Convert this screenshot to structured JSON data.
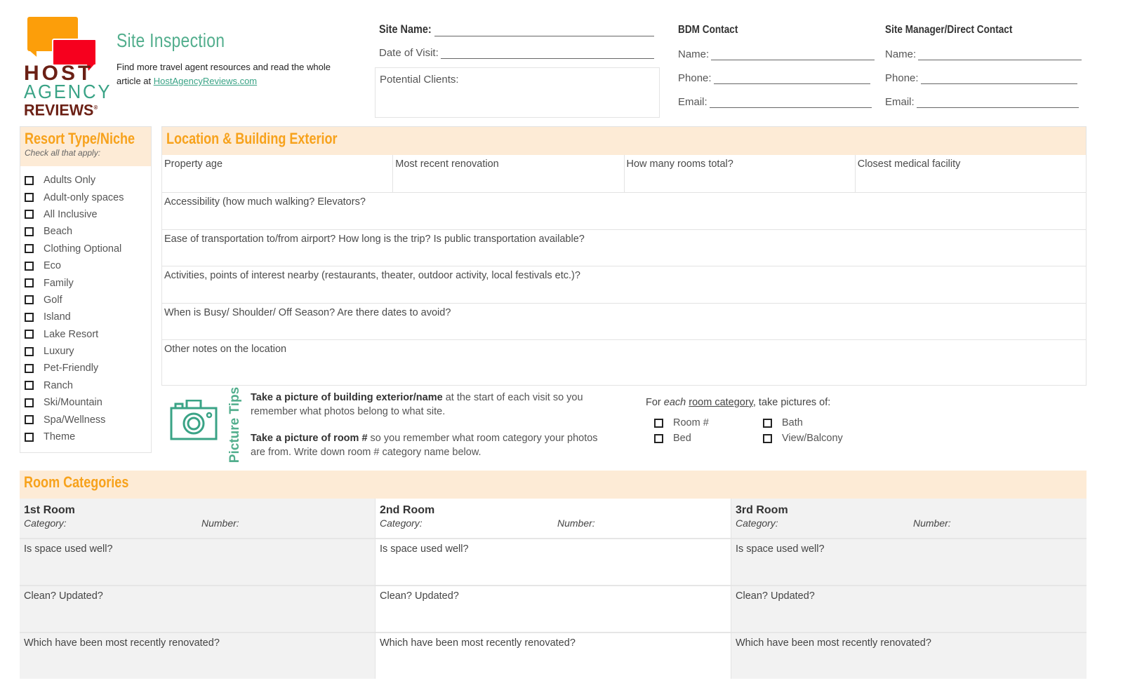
{
  "logo": {
    "line1": "HOST",
    "line2": "AGENCY",
    "line3": "REVIEWS",
    "mark": "®",
    "colors": {
      "orange": "#fc9e0a",
      "red": "#f6001e",
      "brown": "#6b2015",
      "teal": "#3aa386"
    }
  },
  "header": {
    "title": "Site Inspection",
    "subtitle_prefix": "Find more travel agent resources and read the whole article at ",
    "subtitle_link": "HostAgencyReviews.com",
    "site_name_label": "Site Name:",
    "date_label": "Date of Visit:",
    "potential_clients_label": "Potential Clients:"
  },
  "contacts": [
    {
      "title": "BDM Contact",
      "fields": [
        "Name:",
        "Phone:",
        "Email:"
      ]
    },
    {
      "title": "Site Manager/Direct Contact",
      "fields": [
        "Name:",
        "Phone:",
        "Email:"
      ]
    }
  ],
  "resort_type": {
    "title": "Resort Type/Niche",
    "subtitle": "Check all that apply:",
    "options": [
      "Adults Only",
      "Adult-only spaces",
      "All Inclusive",
      "Beach",
      "Clothing Optional",
      "Eco",
      "Family",
      "Golf",
      "Island",
      "Lake Resort",
      "Luxury",
      "Pet-Friendly",
      "Ranch",
      "Ski/Mountain",
      "Spa/Wellness",
      "Theme"
    ]
  },
  "location": {
    "title": "Location & Building Exterior",
    "top_cells": [
      "Property age",
      "Most recent renovation",
      "How many rooms total?",
      "Closest medical facility"
    ],
    "rows": [
      "Accessibility (how much walking? Elevators?",
      "Ease of transportation to/from airport? How long is the trip? Is public transportation available?",
      "Activities, points of interest nearby (restaurants, theater, outdoor activity, local festivals etc.)?",
      "When is Busy/ Shoulder/ Off Season? Are there dates to avoid?",
      "Other notes on the location"
    ]
  },
  "picture_tips": {
    "label": "Picture Tips",
    "icon": "camera-icon",
    "tip1_bold": "Take a picture of building exterior/name",
    "tip1_rest": " at the start of each visit so you remember what photos belong to what site.",
    "tip2_bold": "Take a picture of room #",
    "tip2_rest": " so you remember what room category your photos are from. Write down room # category name below.",
    "each_prefix": "For ",
    "each_em": "each",
    "each_link": "room category",
    "each_suffix": ", take pictures of:",
    "checklist": [
      "Room #",
      "Bath",
      "Bed",
      "View/Balcony"
    ]
  },
  "rooms": {
    "title": "Room Categories",
    "category_label": "Category:",
    "number_label": "Number:",
    "columns": [
      "1st Room",
      "2nd Room",
      "3rd Room"
    ],
    "questions": [
      "Is space used well?",
      "Clean? Updated?",
      "Which have been most recently renovated?"
    ]
  }
}
